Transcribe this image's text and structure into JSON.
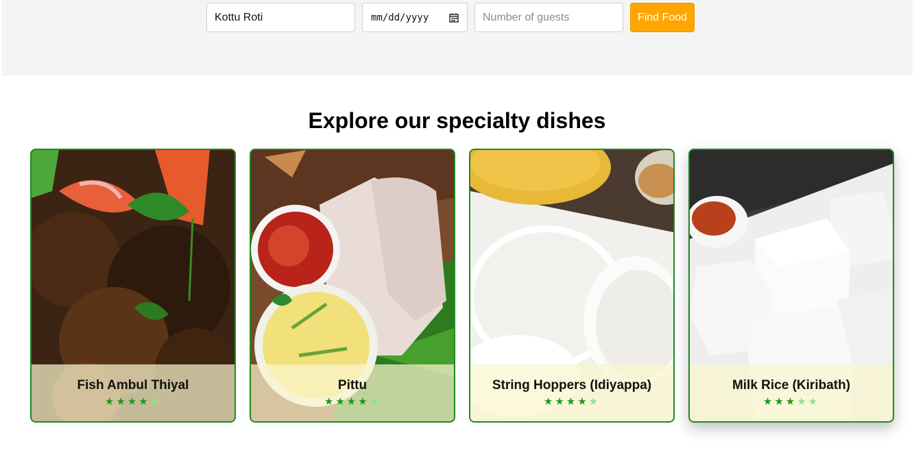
{
  "search": {
    "dish_value": "Kottu Roti",
    "date_placeholder": "mm/dd/yyyy",
    "guests_placeholder": "Number of guests",
    "find_label": "Find Food"
  },
  "section": {
    "title": "Explore our specialty dishes"
  },
  "dishes": [
    {
      "name": "Fish Ambul Thiyal",
      "rating": 4,
      "rating_max": 5
    },
    {
      "name": "Pittu",
      "rating": 4,
      "rating_max": 5
    },
    {
      "name": "String Hoppers (Idiyappa)",
      "rating": 4,
      "rating_max": 5
    },
    {
      "name": "Milk Rice (Kiribath)",
      "rating": 3,
      "rating_max": 5
    }
  ],
  "colors": {
    "accent": "#ffa500",
    "card_border": "#1d8a1d",
    "star_filled": "#1a9a1a",
    "star_empty": "#8fe08f"
  },
  "icons": {
    "date_field": "calendar-icon",
    "rating": "star-icon"
  }
}
